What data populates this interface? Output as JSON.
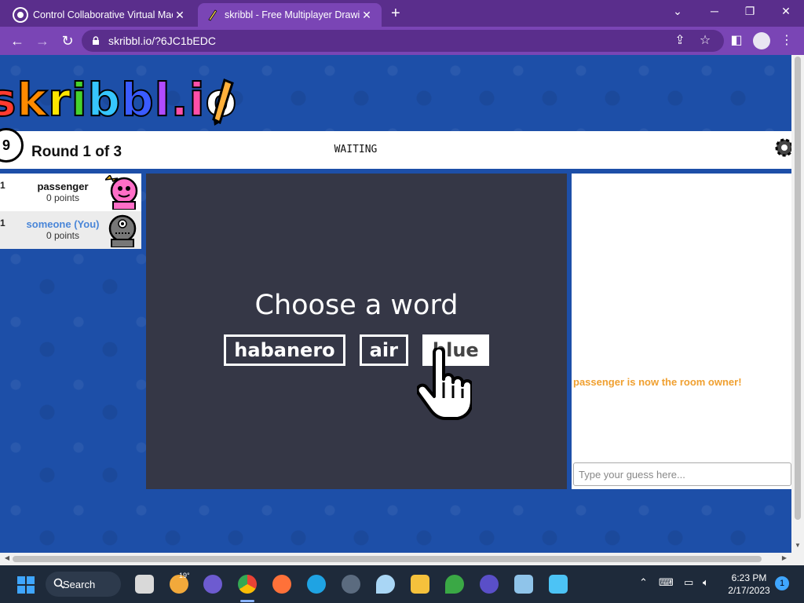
{
  "browser": {
    "tabs": [
      {
        "title": "Control Collaborative Virtual Mac",
        "favicon_color": "#ffffff"
      },
      {
        "title": "skribbl - Free Multiplayer Drawin",
        "favicon_color": "#2b6cff"
      }
    ],
    "new_tab": "+",
    "window_controls": {
      "minimize": "─",
      "maximize": "❐",
      "close": "✕",
      "tab_search": "⌄"
    },
    "url": "skribbl.io/?6JC1bEDC",
    "nav": {
      "back": "←",
      "forward": "→",
      "reload": "↻"
    }
  },
  "game": {
    "logo": "skribbl.io",
    "timer": "9",
    "round_text": "Round 1 of 3",
    "status": "WAITING",
    "players": [
      {
        "rank": "1",
        "name": "passenger",
        "points": "0 points",
        "is_you": false
      },
      {
        "rank": "1",
        "name": "someone (You)",
        "points": "0 points",
        "is_you": true
      }
    ],
    "choose_title": "Choose a word",
    "words": [
      "habanero",
      "air",
      "blue"
    ],
    "chat": {
      "message": "passenger is now the room owner!",
      "message_color": "#f0a030",
      "input_placeholder": "Type your guess here..."
    }
  },
  "taskbar": {
    "search_label": "Search",
    "weather_temp": "19°",
    "time": "6:23 PM",
    "date": "2/17/2023",
    "notification_count": "1"
  }
}
